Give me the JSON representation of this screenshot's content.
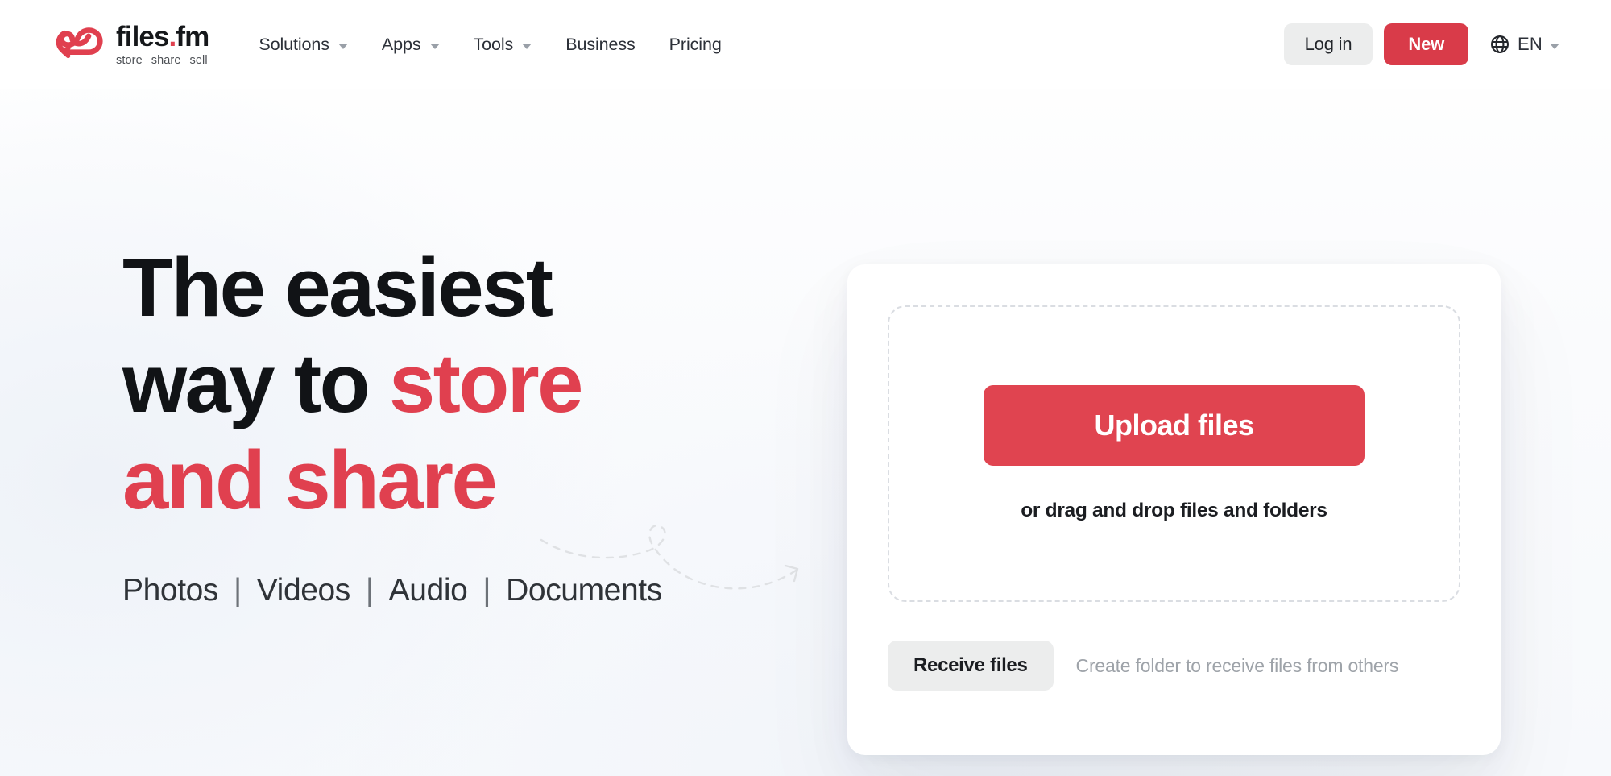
{
  "brand": {
    "name_main": "files",
    "name_dot": ".",
    "name_tld": "fm",
    "tagline": [
      "store",
      "share",
      "sell"
    ],
    "logo_icon": "cloud-infinity-logo",
    "accent_color": "#e0404f"
  },
  "nav": {
    "items": [
      {
        "label": "Solutions",
        "has_dropdown": true
      },
      {
        "label": "Apps",
        "has_dropdown": true
      },
      {
        "label": "Tools",
        "has_dropdown": true
      },
      {
        "label": "Business",
        "has_dropdown": false
      },
      {
        "label": "Pricing",
        "has_dropdown": false
      }
    ]
  },
  "header_actions": {
    "login_label": "Log in",
    "new_label": "New",
    "language_code": "EN",
    "language_icon": "globe-icon",
    "new_button_color": "#d93b49"
  },
  "hero": {
    "headline": {
      "line1": "The easiest",
      "line2_plain": "way to ",
      "line2_accent": "store",
      "line3_accent": "and share"
    },
    "formats": [
      "Photos",
      "Videos",
      "Audio",
      "Documents"
    ],
    "format_separator": "|",
    "decoration": "dashed-curved-arrow"
  },
  "upload_card": {
    "upload_button_label": "Upload files",
    "upload_button_color": "#e04450",
    "drop_hint": "or drag and drop files and folders",
    "receive_button_label": "Receive files",
    "receive_hint": "Create folder to receive files from others"
  }
}
